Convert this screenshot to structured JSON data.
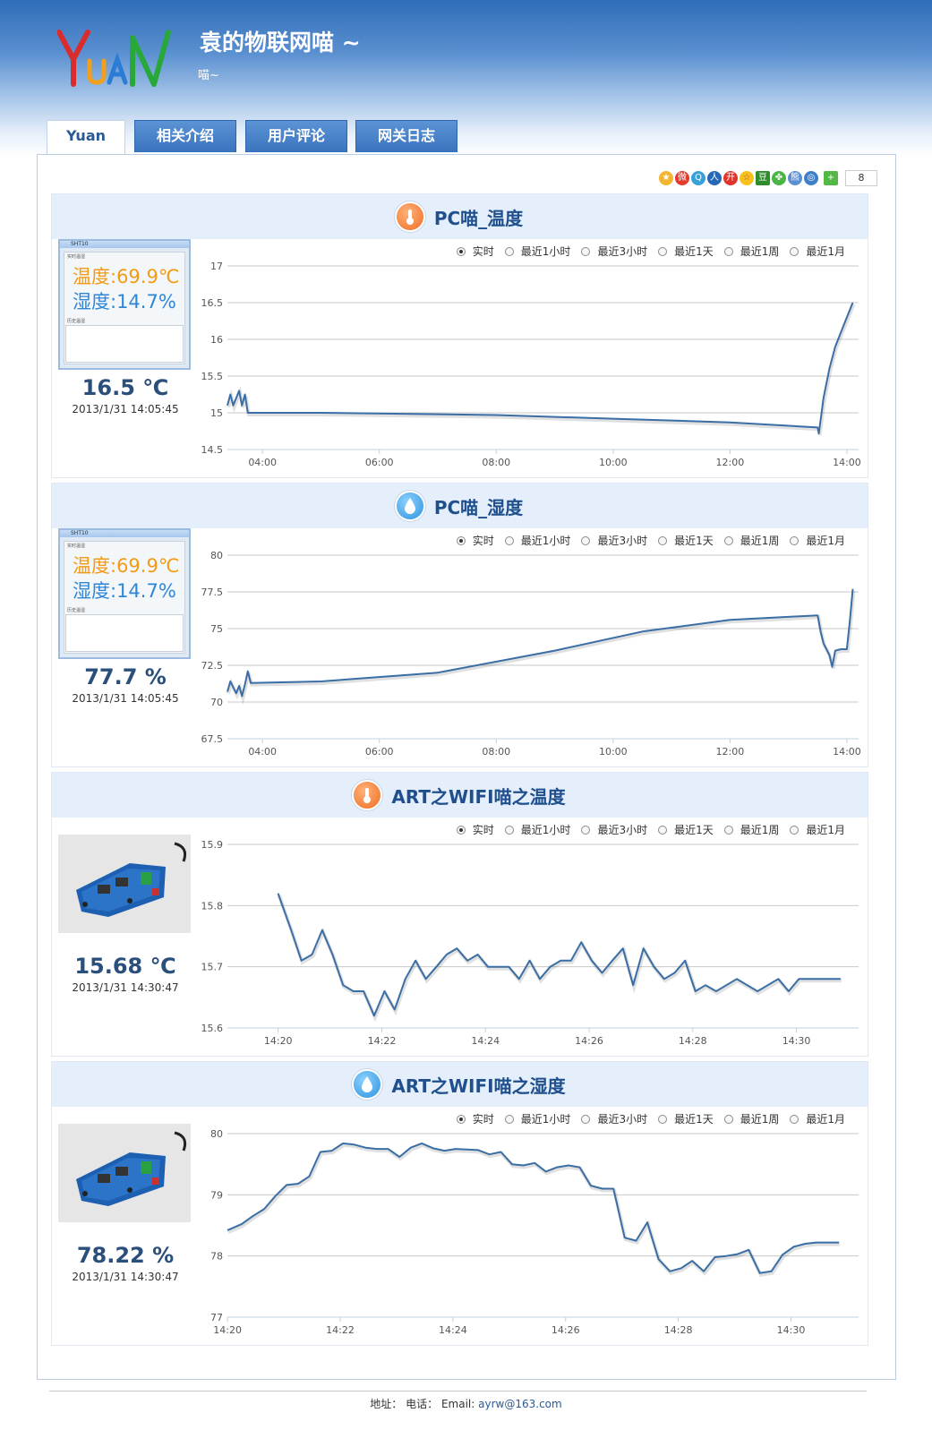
{
  "header": {
    "logo_text": "YuAN",
    "title": "袁的物联网喵 ~",
    "subtitle": "喵~"
  },
  "tabs": [
    {
      "label": "Yuan",
      "active": true
    },
    {
      "label": "相关介绍",
      "active": false
    },
    {
      "label": "用户评论",
      "active": false
    },
    {
      "label": "网关日志",
      "active": false
    }
  ],
  "share": {
    "icons": [
      "qzone-icon",
      "weibo-icon",
      "qq-weibo-icon",
      "renren-icon",
      "kaixin-icon",
      "favorite-icon",
      "douban-icon",
      "clover-icon",
      "tieba-icon",
      "globe-icon",
      "more-icon"
    ],
    "count": "8"
  },
  "ranges": [
    "实时",
    "最近1小时",
    "最近3小时",
    "最近1天",
    "最近1周",
    "最近1月"
  ],
  "panels": [
    {
      "title": "PC喵_温度",
      "icon": "thermometer-icon",
      "thumb": {
        "type": "window",
        "line1": "温度:69.9℃",
        "line2": "湿度:14.7%"
      },
      "value": "16.5 ℃",
      "time": "2013/1/31 14:05:45",
      "selected_range": "实时"
    },
    {
      "title": "PC喵_湿度",
      "icon": "water-drop-icon",
      "thumb": {
        "type": "window",
        "line1": "温度:69.9℃",
        "line2": "湿度:14.7%"
      },
      "value": "77.7 %",
      "time": "2013/1/31 14:05:45",
      "selected_range": "实时"
    },
    {
      "title": "ART之WIFI喵之温度",
      "icon": "thermometer-icon",
      "thumb": {
        "type": "photo"
      },
      "value": "15.68 ℃",
      "time": "2013/1/31 14:30:47",
      "selected_range": "实时"
    },
    {
      "title": "ART之WIFI喵之湿度",
      "icon": "water-drop-icon",
      "thumb": {
        "type": "photo"
      },
      "value": "78.22 %",
      "time": "2013/1/31 14:30:47",
      "selected_range": "实时"
    }
  ],
  "chart_data": [
    {
      "type": "line",
      "color": "#3a6ea5",
      "yticks": [
        "17",
        "16.5",
        "16",
        "15.5",
        "15",
        "14.5"
      ],
      "ylim": [
        14.5,
        17
      ],
      "xticks": [
        "04:00",
        "06:00",
        "08:00",
        "10:00",
        "12:00",
        "14:00"
      ],
      "xlim": [
        3.4,
        14.2
      ],
      "series": [
        {
          "x": [
            3.4,
            3.45,
            3.5,
            3.55,
            3.6,
            3.65,
            3.7,
            3.75,
            3.8,
            5,
            8,
            10,
            12,
            13.5,
            13.52,
            13.6,
            13.7,
            13.8,
            13.9,
            14.0,
            14.1
          ],
          "values": [
            15.1,
            15.25,
            15.1,
            15.2,
            15.3,
            15.1,
            15.25,
            15.0,
            15.0,
            15.0,
            14.97,
            14.92,
            14.87,
            14.8,
            14.72,
            15.2,
            15.6,
            15.9,
            16.1,
            16.3,
            16.5
          ]
        }
      ]
    },
    {
      "type": "line",
      "color": "#3a6ea5",
      "yticks": [
        "80",
        "77.5",
        "75",
        "72.5",
        "70",
        "67.5"
      ],
      "ylim": [
        67.5,
        80
      ],
      "xticks": [
        "04:00",
        "06:00",
        "08:00",
        "10:00",
        "12:00",
        "14:00"
      ],
      "xlim": [
        3.4,
        14.2
      ],
      "series": [
        {
          "x": [
            3.4,
            3.45,
            3.5,
            3.55,
            3.6,
            3.65,
            3.7,
            3.75,
            3.8,
            5,
            7,
            9,
            10.5,
            12,
            13.5,
            13.55,
            13.6,
            13.7,
            13.75,
            13.8,
            13.9,
            14.0,
            14.05,
            14.1
          ],
          "values": [
            70.7,
            71.4,
            71.0,
            70.6,
            71.1,
            70.4,
            71.2,
            72.1,
            71.3,
            71.4,
            72.0,
            73.5,
            74.8,
            75.6,
            75.9,
            74.8,
            74.0,
            73.2,
            72.4,
            73.5,
            73.6,
            73.6,
            75.5,
            77.7
          ]
        }
      ]
    },
    {
      "type": "line",
      "color": "#3a6ea5",
      "yticks": [
        "15.9",
        "15.8",
        "15.7",
        "15.6"
      ],
      "ylim": [
        15.6,
        15.9
      ],
      "xticks": [
        "14:20",
        "14:22",
        "14:24",
        "14:26",
        "14:28",
        "14:30"
      ],
      "xlim": [
        14.317,
        14.52
      ],
      "series": [
        {
          "x": [
            14.3333,
            14.3375,
            14.3408,
            14.3442,
            14.3475,
            14.3508,
            14.3542,
            14.3575,
            14.3608,
            14.3642,
            14.3675,
            14.3708,
            14.3742,
            14.3775,
            14.3808,
            14.3842,
            14.3875,
            14.3908,
            14.3942,
            14.3975,
            14.4008,
            14.4042,
            14.4075,
            14.4108,
            14.4142,
            14.4175,
            14.4208,
            14.4242,
            14.4275,
            14.4308,
            14.4342,
            14.4375,
            14.4408,
            14.4442,
            14.4475,
            14.4508,
            14.4542,
            14.4575,
            14.4608,
            14.4642,
            14.4675,
            14.4708,
            14.4742,
            14.4775,
            14.4808,
            14.4842,
            14.4875,
            14.4908,
            14.4942,
            14.4975,
            14.5008,
            14.5042,
            14.5075,
            14.5108,
            14.5142
          ],
          "values": [
            15.82,
            15.76,
            15.71,
            15.72,
            15.76,
            15.72,
            15.67,
            15.66,
            15.66,
            15.62,
            15.66,
            15.63,
            15.68,
            15.71,
            15.68,
            15.7,
            15.72,
            15.73,
            15.71,
            15.72,
            15.7,
            15.7,
            15.7,
            15.68,
            15.71,
            15.68,
            15.7,
            15.71,
            15.71,
            15.74,
            15.71,
            15.69,
            15.71,
            15.73,
            15.67,
            15.73,
            15.7,
            15.68,
            15.69,
            15.71,
            15.66,
            15.67,
            15.66,
            15.67,
            15.68,
            15.67,
            15.66,
            15.67,
            15.68,
            15.66,
            15.68,
            15.68,
            15.68,
            15.68,
            15.68
          ]
        }
      ]
    },
    {
      "type": "line",
      "color": "#3a6ea5",
      "yticks": [
        "80",
        "79",
        "78",
        "77"
      ],
      "ylim": [
        77,
        80
      ],
      "xticks": [
        "14:20",
        "14:22",
        "14:24",
        "14:26",
        "14:28",
        "14:30"
      ],
      "xlim": [
        14.3333,
        14.52
      ],
      "series": [
        {
          "x": [
            14.3333,
            14.3375,
            14.3408,
            14.3442,
            14.3475,
            14.3508,
            14.3542,
            14.3575,
            14.3608,
            14.3642,
            14.3675,
            14.3708,
            14.3742,
            14.3775,
            14.3808,
            14.3842,
            14.3875,
            14.3908,
            14.3942,
            14.3975,
            14.4008,
            14.4042,
            14.4075,
            14.4108,
            14.4142,
            14.4175,
            14.4208,
            14.4242,
            14.4275,
            14.4308,
            14.4342,
            14.4375,
            14.4408,
            14.4442,
            14.4475,
            14.4508,
            14.4542,
            14.4575,
            14.4608,
            14.4642,
            14.4675,
            14.4708,
            14.4742,
            14.4775,
            14.4808,
            14.4842,
            14.4875,
            14.4908,
            14.4942,
            14.4975,
            14.5008,
            14.5042,
            14.5075,
            14.5108,
            14.5142
          ],
          "values": [
            78.42,
            78.52,
            78.65,
            78.77,
            78.98,
            79.16,
            79.18,
            79.3,
            79.7,
            79.72,
            79.84,
            79.82,
            79.77,
            79.75,
            79.75,
            79.62,
            79.77,
            79.84,
            79.76,
            79.72,
            79.75,
            79.74,
            79.73,
            79.66,
            79.7,
            79.5,
            79.48,
            79.52,
            79.38,
            79.45,
            79.48,
            79.45,
            79.15,
            79.1,
            79.1,
            78.3,
            78.25,
            78.55,
            77.95,
            77.75,
            77.8,
            77.92,
            77.75,
            77.98,
            78.0,
            78.03,
            78.1,
            77.72,
            77.75,
            78.02,
            78.15,
            78.2,
            78.22,
            78.22,
            78.22
          ]
        }
      ]
    }
  ],
  "footer": {
    "addr_label": "地址：",
    "tel_label": "电话：",
    "email_label": "Email:",
    "email": "ayrw@163.com"
  }
}
